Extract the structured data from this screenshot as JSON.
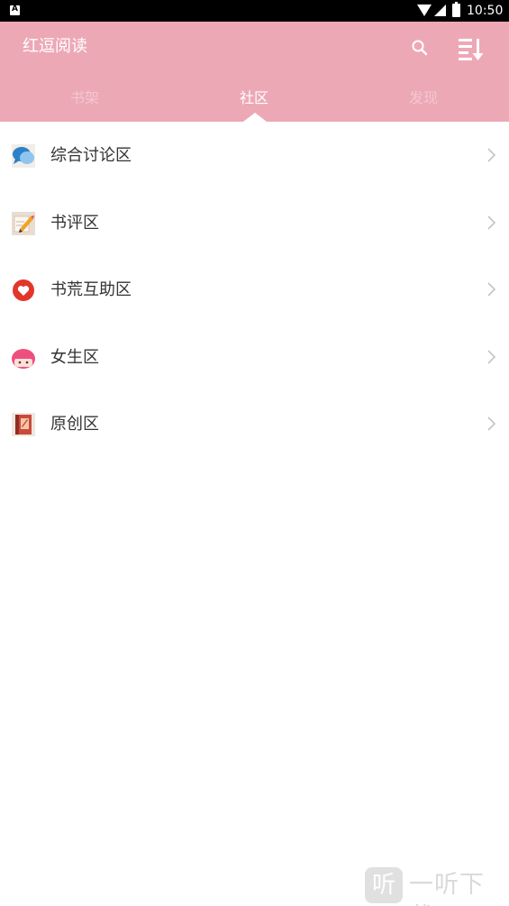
{
  "status_bar": {
    "time": "10:50",
    "icons": [
      "notification-icon",
      "wifi-icon",
      "signal-icon",
      "battery-icon"
    ]
  },
  "header": {
    "title": "红逗阅读",
    "actions": [
      "search-icon",
      "sort-icon"
    ],
    "background_color": "#eda8b6"
  },
  "tabs": [
    {
      "label": "书架",
      "selected": false
    },
    {
      "label": "社区",
      "selected": true
    },
    {
      "label": "发现",
      "selected": false
    }
  ],
  "community": {
    "items": [
      {
        "label": "综合讨论区",
        "icon": "chat-bubbles-icon"
      },
      {
        "label": "书评区",
        "icon": "pencil-note-icon"
      },
      {
        "label": "书荒互助区",
        "icon": "heart-icon"
      },
      {
        "label": "女生区",
        "icon": "girl-face-icon"
      },
      {
        "label": "原创区",
        "icon": "book-icon"
      }
    ]
  },
  "watermark": {
    "logo_glyph": "听",
    "text": "一听下载"
  }
}
